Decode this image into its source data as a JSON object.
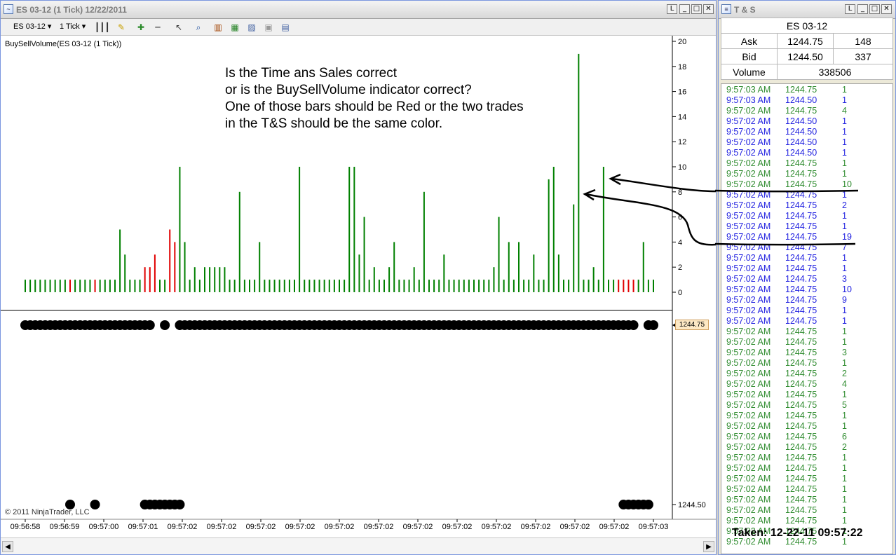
{
  "chart_window": {
    "title": "ES 03-12 (1 Tick)  12/22/2011",
    "toolbar": {
      "instrument": "ES 03-12",
      "period": "1 Tick"
    },
    "indicator_label": "BuySellVolume(ES 03-12 (1 Tick))",
    "copyright": "© 2011 NinjaTrader, LLC",
    "price_tag": "1244.75",
    "annotation": "Is the Time ans Sales correct\nor is the BuySellVolume indicator correct?\nOne of those bars should be Red or the two trades\nin the T&S should be the same color."
  },
  "chart_data": {
    "type": "bar",
    "title": "",
    "ylim": [
      0,
      20
    ],
    "yticks": [
      "20",
      "18",
      "16",
      "14",
      "12",
      "10",
      "8",
      "6",
      "4",
      "2",
      "0"
    ],
    "price_axis_labels": [
      "1244.50"
    ],
    "x_tick_labels": [
      "09:56:58",
      "09:56:59",
      "09:57:00",
      "09:57:01",
      "09:57:02",
      "09:57:02",
      "09:57:02",
      "09:57:02",
      "09:57:02",
      "09:57:02",
      "09:57:02",
      "09:57:02",
      "09:57:02",
      "09:57:02",
      "09:57:02",
      "09:57:02",
      "09:57:03"
    ],
    "volume_bars": [
      {
        "v": 1,
        "c": "g"
      },
      {
        "v": 1,
        "c": "g"
      },
      {
        "v": 1,
        "c": "g"
      },
      {
        "v": 1,
        "c": "g"
      },
      {
        "v": 1,
        "c": "g"
      },
      {
        "v": 1,
        "c": "g"
      },
      {
        "v": 1,
        "c": "g"
      },
      {
        "v": 1,
        "c": "g"
      },
      {
        "v": 1,
        "c": "g"
      },
      {
        "v": 1,
        "c": "r"
      },
      {
        "v": 1,
        "c": "g"
      },
      {
        "v": 1,
        "c": "g"
      },
      {
        "v": 1,
        "c": "g"
      },
      {
        "v": 1,
        "c": "g"
      },
      {
        "v": 1,
        "c": "r"
      },
      {
        "v": 1,
        "c": "g"
      },
      {
        "v": 1,
        "c": "g"
      },
      {
        "v": 1,
        "c": "g"
      },
      {
        "v": 1,
        "c": "g"
      },
      {
        "v": 5,
        "c": "g"
      },
      {
        "v": 3,
        "c": "g"
      },
      {
        "v": 1,
        "c": "g"
      },
      {
        "v": 1,
        "c": "g"
      },
      {
        "v": 1,
        "c": "g"
      },
      {
        "v": 2,
        "c": "r"
      },
      {
        "v": 2,
        "c": "r"
      },
      {
        "v": 3,
        "c": "r"
      },
      {
        "v": 1,
        "c": "g"
      },
      {
        "v": 1,
        "c": "g"
      },
      {
        "v": 5,
        "c": "r"
      },
      {
        "v": 4,
        "c": "r"
      },
      {
        "v": 10,
        "c": "g"
      },
      {
        "v": 4,
        "c": "g"
      },
      {
        "v": 1,
        "c": "g"
      },
      {
        "v": 2,
        "c": "g"
      },
      {
        "v": 1,
        "c": "g"
      },
      {
        "v": 2,
        "c": "g"
      },
      {
        "v": 2,
        "c": "g"
      },
      {
        "v": 2,
        "c": "g"
      },
      {
        "v": 2,
        "c": "g"
      },
      {
        "v": 2,
        "c": "g"
      },
      {
        "v": 1,
        "c": "g"
      },
      {
        "v": 1,
        "c": "g"
      },
      {
        "v": 8,
        "c": "g"
      },
      {
        "v": 1,
        "c": "g"
      },
      {
        "v": 1,
        "c": "g"
      },
      {
        "v": 1,
        "c": "g"
      },
      {
        "v": 4,
        "c": "g"
      },
      {
        "v": 1,
        "c": "g"
      },
      {
        "v": 1,
        "c": "g"
      },
      {
        "v": 1,
        "c": "g"
      },
      {
        "v": 1,
        "c": "g"
      },
      {
        "v": 1,
        "c": "g"
      },
      {
        "v": 1,
        "c": "g"
      },
      {
        "v": 1,
        "c": "g"
      },
      {
        "v": 10,
        "c": "g"
      },
      {
        "v": 1,
        "c": "g"
      },
      {
        "v": 1,
        "c": "g"
      },
      {
        "v": 1,
        "c": "g"
      },
      {
        "v": 1,
        "c": "g"
      },
      {
        "v": 1,
        "c": "g"
      },
      {
        "v": 1,
        "c": "g"
      },
      {
        "v": 1,
        "c": "g"
      },
      {
        "v": 1,
        "c": "g"
      },
      {
        "v": 1,
        "c": "g"
      },
      {
        "v": 10,
        "c": "g"
      },
      {
        "v": 10,
        "c": "g"
      },
      {
        "v": 3,
        "c": "g"
      },
      {
        "v": 6,
        "c": "g"
      },
      {
        "v": 1,
        "c": "g"
      },
      {
        "v": 2,
        "c": "g"
      },
      {
        "v": 1,
        "c": "g"
      },
      {
        "v": 1,
        "c": "g"
      },
      {
        "v": 2,
        "c": "g"
      },
      {
        "v": 4,
        "c": "g"
      },
      {
        "v": 1,
        "c": "g"
      },
      {
        "v": 1,
        "c": "g"
      },
      {
        "v": 1,
        "c": "g"
      },
      {
        "v": 2,
        "c": "g"
      },
      {
        "v": 1,
        "c": "g"
      },
      {
        "v": 8,
        "c": "g"
      },
      {
        "v": 1,
        "c": "g"
      },
      {
        "v": 1,
        "c": "g"
      },
      {
        "v": 1,
        "c": "g"
      },
      {
        "v": 3,
        "c": "g"
      },
      {
        "v": 1,
        "c": "g"
      },
      {
        "v": 1,
        "c": "g"
      },
      {
        "v": 1,
        "c": "g"
      },
      {
        "v": 1,
        "c": "g"
      },
      {
        "v": 1,
        "c": "g"
      },
      {
        "v": 1,
        "c": "g"
      },
      {
        "v": 1,
        "c": "g"
      },
      {
        "v": 1,
        "c": "g"
      },
      {
        "v": 1,
        "c": "g"
      },
      {
        "v": 2,
        "c": "g"
      },
      {
        "v": 6,
        "c": "g"
      },
      {
        "v": 1,
        "c": "g"
      },
      {
        "v": 4,
        "c": "g"
      },
      {
        "v": 1,
        "c": "g"
      },
      {
        "v": 4,
        "c": "g"
      },
      {
        "v": 1,
        "c": "g"
      },
      {
        "v": 1,
        "c": "g"
      },
      {
        "v": 3,
        "c": "g"
      },
      {
        "v": 1,
        "c": "g"
      },
      {
        "v": 1,
        "c": "g"
      },
      {
        "v": 9,
        "c": "g"
      },
      {
        "v": 10,
        "c": "g"
      },
      {
        "v": 3,
        "c": "g"
      },
      {
        "v": 1,
        "c": "g"
      },
      {
        "v": 1,
        "c": "g"
      },
      {
        "v": 7,
        "c": "g"
      },
      {
        "v": 19,
        "c": "g"
      },
      {
        "v": 1,
        "c": "g"
      },
      {
        "v": 1,
        "c": "g"
      },
      {
        "v": 2,
        "c": "g"
      },
      {
        "v": 1,
        "c": "g"
      },
      {
        "v": 10,
        "c": "g"
      },
      {
        "v": 1,
        "c": "g"
      },
      {
        "v": 1,
        "c": "g"
      },
      {
        "v": 1,
        "c": "r"
      },
      {
        "v": 1,
        "c": "r"
      },
      {
        "v": 1,
        "c": "r"
      },
      {
        "v": 1,
        "c": "r"
      },
      {
        "v": 1,
        "c": "g"
      },
      {
        "v": 4,
        "c": "g"
      },
      {
        "v": 1,
        "c": "g"
      },
      {
        "v": 1,
        "c": "g"
      }
    ],
    "price_trades_1244_75": [
      0,
      1,
      2,
      3,
      4,
      5,
      6,
      7,
      8,
      9,
      10,
      11,
      12,
      13,
      14,
      15,
      16,
      17,
      18,
      19,
      20,
      21,
      22,
      23,
      24,
      25,
      28,
      31,
      32,
      33,
      34,
      35,
      36,
      37,
      38,
      39,
      40,
      41,
      42,
      43,
      44,
      45,
      46,
      47,
      48,
      49,
      50,
      51,
      52,
      53,
      54,
      55,
      56,
      57,
      58,
      59,
      60,
      61,
      62,
      63,
      64,
      65,
      66,
      67,
      68,
      69,
      70,
      71,
      72,
      73,
      74,
      75,
      76,
      77,
      78,
      79,
      80,
      81,
      82,
      83,
      84,
      85,
      86,
      87,
      88,
      89,
      90,
      91,
      92,
      93,
      94,
      95,
      96,
      97,
      98,
      99,
      100,
      101,
      102,
      103,
      104,
      105,
      106,
      107,
      108,
      109,
      110,
      111,
      112,
      113,
      114,
      115,
      116,
      117,
      118,
      119,
      120,
      121,
      122,
      125,
      126
    ],
    "price_trades_1244_50": [
      9,
      14,
      24,
      25,
      26,
      27,
      28,
      29,
      30,
      31,
      120,
      121,
      122,
      123,
      124,
      125
    ],
    "colors": {
      "buy": "#008000",
      "sell": "#e00000"
    }
  },
  "ts_window": {
    "title": "T & S",
    "instrument": "ES 03-12",
    "ask_label": "Ask",
    "ask_price": "1244.75",
    "ask_size": "148",
    "bid_label": "Bid",
    "bid_price": "1244.50",
    "bid_size": "337",
    "volume_label": "Volume",
    "volume": "338506",
    "rows": [
      {
        "t": "9:57:03 AM",
        "p": "1244.75",
        "s": "1",
        "c": "#2e8b2e"
      },
      {
        "t": "9:57:03 AM",
        "p": "1244.50",
        "s": "1",
        "c": "#1f1fe0"
      },
      {
        "t": "9:57:02 AM",
        "p": "1244.75",
        "s": "4",
        "c": "#2e8b2e"
      },
      {
        "t": "9:57:02 AM",
        "p": "1244.50",
        "s": "1",
        "c": "#1f1fe0"
      },
      {
        "t": "9:57:02 AM",
        "p": "1244.50",
        "s": "1",
        "c": "#1f1fe0"
      },
      {
        "t": "9:57:02 AM",
        "p": "1244.50",
        "s": "1",
        "c": "#1f1fe0"
      },
      {
        "t": "9:57:02 AM",
        "p": "1244.50",
        "s": "1",
        "c": "#1f1fe0"
      },
      {
        "t": "9:57:02 AM",
        "p": "1244.75",
        "s": "1",
        "c": "#2e8b2e"
      },
      {
        "t": "9:57:02 AM",
        "p": "1244.75",
        "s": "1",
        "c": "#2e8b2e"
      },
      {
        "t": "9:57:02 AM",
        "p": "1244.75",
        "s": "10",
        "c": "#2e8b2e"
      },
      {
        "t": "9:57:02 AM",
        "p": "1244.75",
        "s": "1",
        "c": "#1f1fe0"
      },
      {
        "t": "9:57:02 AM",
        "p": "1244.75",
        "s": "2",
        "c": "#1f1fe0"
      },
      {
        "t": "9:57:02 AM",
        "p": "1244.75",
        "s": "1",
        "c": "#1f1fe0"
      },
      {
        "t": "9:57:02 AM",
        "p": "1244.75",
        "s": "1",
        "c": "#1f1fe0"
      },
      {
        "t": "9:57:02 AM",
        "p": "1244.75",
        "s": "19",
        "c": "#1f1fe0"
      },
      {
        "t": "9:57:02 AM",
        "p": "1244.75",
        "s": "7",
        "c": "#1f1fe0"
      },
      {
        "t": "9:57:02 AM",
        "p": "1244.75",
        "s": "1",
        "c": "#1f1fe0"
      },
      {
        "t": "9:57:02 AM",
        "p": "1244.75",
        "s": "1",
        "c": "#1f1fe0"
      },
      {
        "t": "9:57:02 AM",
        "p": "1244.75",
        "s": "3",
        "c": "#1f1fe0"
      },
      {
        "t": "9:57:02 AM",
        "p": "1244.75",
        "s": "10",
        "c": "#1f1fe0"
      },
      {
        "t": "9:57:02 AM",
        "p": "1244.75",
        "s": "9",
        "c": "#1f1fe0"
      },
      {
        "t": "9:57:02 AM",
        "p": "1244.75",
        "s": "1",
        "c": "#1f1fe0"
      },
      {
        "t": "9:57:02 AM",
        "p": "1244.75",
        "s": "1",
        "c": "#1f1fe0"
      },
      {
        "t": "9:57:02 AM",
        "p": "1244.75",
        "s": "1",
        "c": "#2e8b2e"
      },
      {
        "t": "9:57:02 AM",
        "p": "1244.75",
        "s": "1",
        "c": "#2e8b2e"
      },
      {
        "t": "9:57:02 AM",
        "p": "1244.75",
        "s": "3",
        "c": "#2e8b2e"
      },
      {
        "t": "9:57:02 AM",
        "p": "1244.75",
        "s": "1",
        "c": "#2e8b2e"
      },
      {
        "t": "9:57:02 AM",
        "p": "1244.75",
        "s": "2",
        "c": "#2e8b2e"
      },
      {
        "t": "9:57:02 AM",
        "p": "1244.75",
        "s": "4",
        "c": "#2e8b2e"
      },
      {
        "t": "9:57:02 AM",
        "p": "1244.75",
        "s": "1",
        "c": "#2e8b2e"
      },
      {
        "t": "9:57:02 AM",
        "p": "1244.75",
        "s": "5",
        "c": "#2e8b2e"
      },
      {
        "t": "9:57:02 AM",
        "p": "1244.75",
        "s": "1",
        "c": "#2e8b2e"
      },
      {
        "t": "9:57:02 AM",
        "p": "1244.75",
        "s": "1",
        "c": "#2e8b2e"
      },
      {
        "t": "9:57:02 AM",
        "p": "1244.75",
        "s": "6",
        "c": "#2e8b2e"
      },
      {
        "t": "9:57:02 AM",
        "p": "1244.75",
        "s": "2",
        "c": "#2e8b2e"
      },
      {
        "t": "9:57:02 AM",
        "p": "1244.75",
        "s": "1",
        "c": "#2e8b2e"
      },
      {
        "t": "9:57:02 AM",
        "p": "1244.75",
        "s": "1",
        "c": "#2e8b2e"
      },
      {
        "t": "9:57:02 AM",
        "p": "1244.75",
        "s": "1",
        "c": "#2e8b2e"
      },
      {
        "t": "9:57:02 AM",
        "p": "1244.75",
        "s": "1",
        "c": "#2e8b2e"
      },
      {
        "t": "9:57:02 AM",
        "p": "1244.75",
        "s": "1",
        "c": "#2e8b2e"
      },
      {
        "t": "9:57:02 AM",
        "p": "1244.75",
        "s": "1",
        "c": "#2e8b2e"
      },
      {
        "t": "9:57:02 AM",
        "p": "1244.75",
        "s": "1",
        "c": "#2e8b2e"
      },
      {
        "t": "9:57:02 AM",
        "p": "1244.75",
        "s": "1",
        "c": "#2e8b2e"
      },
      {
        "t": "9:57:02 AM",
        "p": "1244.75",
        "s": "1",
        "c": "#2e8b2e"
      }
    ],
    "taken": "Taken: 12-22-11 09:57:22"
  }
}
